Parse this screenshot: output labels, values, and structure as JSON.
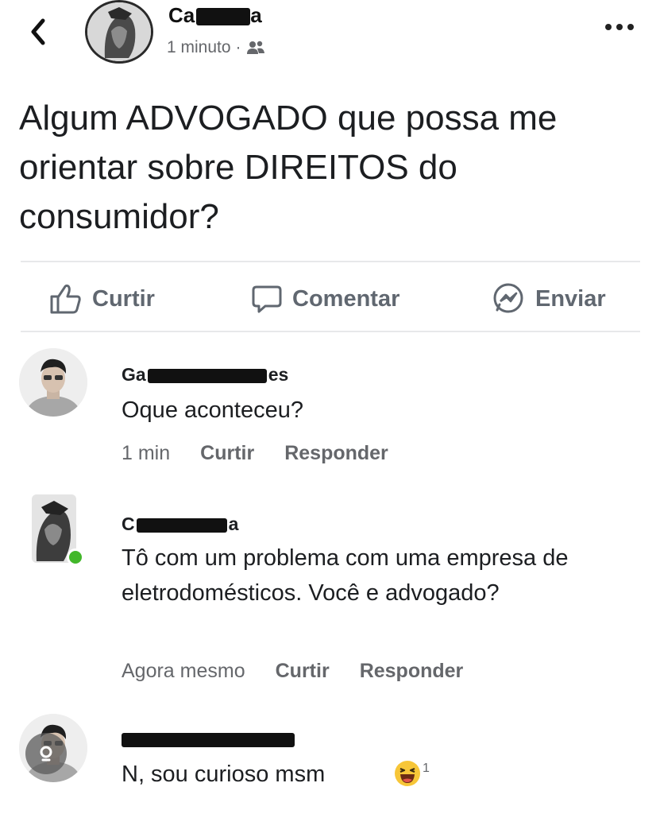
{
  "post": {
    "author": "Ca",
    "author_suffix": "a",
    "time": "1 minuto",
    "text": "Algum ADVOGADO que possa me orientar sobre DIREITOS do consumidor?"
  },
  "actions": {
    "like": "Curtir",
    "comment": "Comentar",
    "send": "Enviar"
  },
  "comments": [
    {
      "name": "Ga",
      "name_suffix": "es",
      "text": "Oque aconteceu?",
      "time": "1 min",
      "like": "Curtir",
      "reply": "Responder"
    },
    {
      "name": "C",
      "name_suffix": "a",
      "text": "Tô com um problema com uma empresa de eletrodomésticos. Você e advogado?",
      "time": "Agora mesmo",
      "like": "Curtir",
      "reply": "Responder",
      "online_color": "#42b72a"
    },
    {
      "name": "",
      "text": "N, sou curioso msm",
      "reaction_count": "1"
    }
  ],
  "icons": {
    "back": "chevron-left-icon",
    "audience": "friends-icon",
    "more": "more-horizontal-icon",
    "like": "thumbs-up-icon",
    "comment": "speech-bubble-icon",
    "send": "messenger-icon",
    "reaction": "haha-emoji-icon",
    "watermark": "circle-badge-icon"
  }
}
